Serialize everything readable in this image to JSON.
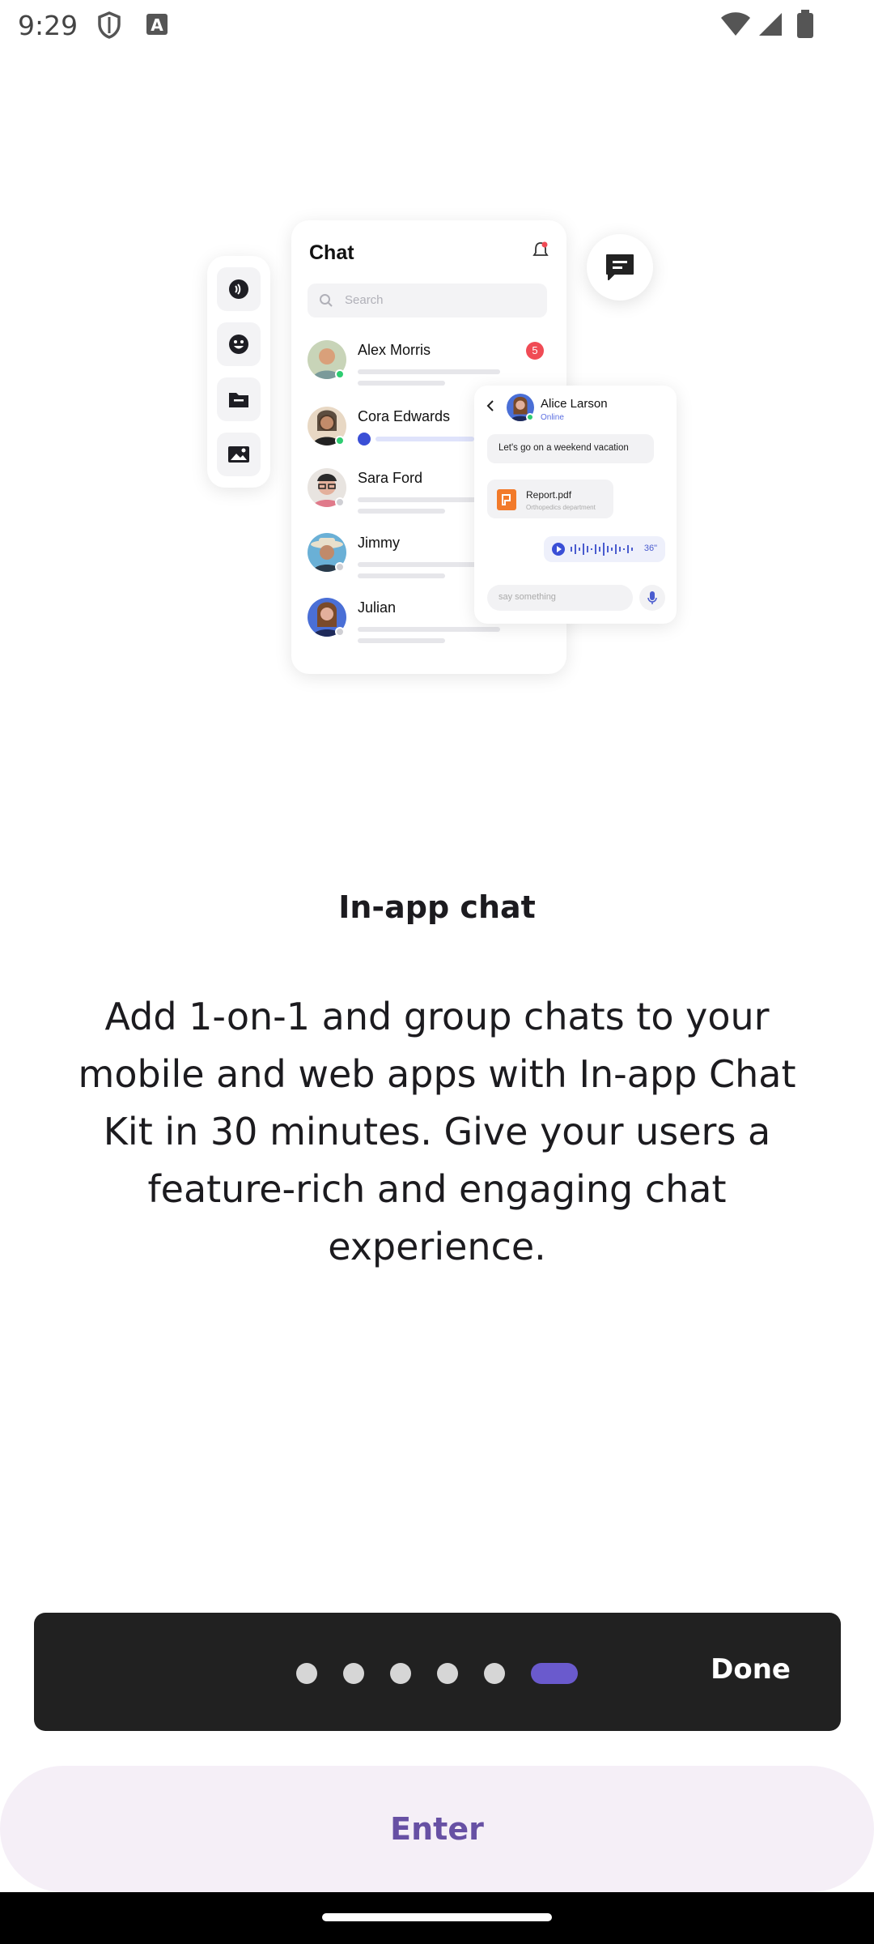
{
  "status_bar": {
    "time": "9:29",
    "icons": [
      "shield-icon",
      "a-box-icon",
      "wifi-icon",
      "signal-icon",
      "battery-icon"
    ]
  },
  "illustration": {
    "rail_icons": [
      "audio-icon",
      "emoji-icon",
      "folder-icon",
      "image-icon"
    ],
    "chat_title": "Chat",
    "search_placeholder": "Search",
    "contacts": [
      {
        "name": "Alex Morris",
        "badge": "5",
        "status_color": "#2ecc71",
        "avatar_color": "#d9a07a"
      },
      {
        "name": "Cora Edwards",
        "status_color": "#2ecc71",
        "avatar_color": "#a8775a"
      },
      {
        "name": "Sara Ford",
        "status_color": "#cfcfd4",
        "avatar_color": "#c99a88"
      },
      {
        "name": "Jimmy",
        "status_color": "#cfcfd4",
        "avatar_color": "#4a8fb5"
      },
      {
        "name": "Julian",
        "status_color": "#cfcfd4",
        "avatar_color": "#5a7fd6"
      }
    ],
    "conversation": {
      "name": "Alice Larson",
      "status": "Online",
      "message": "Let's go on a weekend vacation",
      "file_name": "Report.pdf",
      "file_subtitle": "Orthopedics department",
      "voice_duration": "36\"",
      "input_placeholder": "say something"
    }
  },
  "onboarding": {
    "title": "In-app chat",
    "description": "Add 1-on-1 and group chats to your mobile and web apps with In-app Chat Kit in 30 minutes. Give your users a feature-rich and engaging chat experience."
  },
  "pager": {
    "total_pages": 6,
    "current_page": 6,
    "done_label": "Done",
    "accent_color": "#6a5acd"
  },
  "enter_label": "Enter",
  "colors": {
    "primary": "#6750a4",
    "pager_bg": "#212121",
    "button_bg": "#f5eff7"
  }
}
